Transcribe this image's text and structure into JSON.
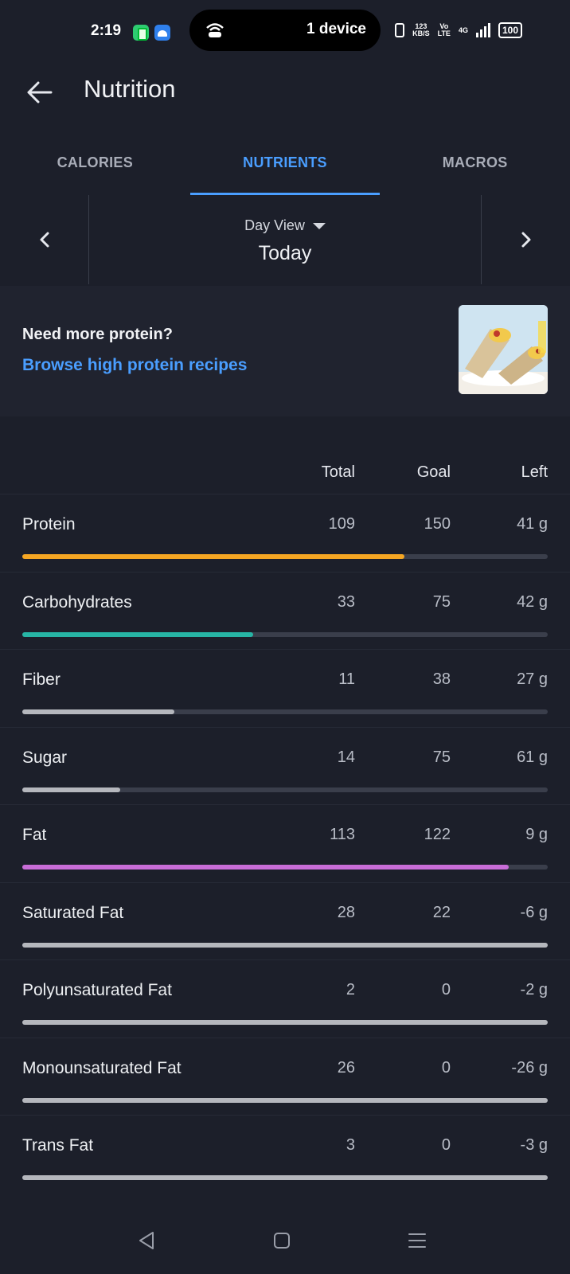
{
  "status_bar": {
    "time": "2:19",
    "pill_text": "1 device",
    "speed_top": "123",
    "speed_bottom": "KB/S",
    "volte_top": "Vo",
    "volte_bottom": "LTE",
    "network": "4G",
    "battery": "100"
  },
  "header": {
    "title": "Nutrition",
    "back_icon": "arrow-left-icon"
  },
  "tabs": [
    {
      "label": "CALORIES",
      "active": false
    },
    {
      "label": "NUTRIENTS",
      "active": true
    },
    {
      "label": "MACROS",
      "active": false
    }
  ],
  "date_nav": {
    "view_label": "Day View",
    "day": "Today"
  },
  "promo": {
    "question": "Need more protein?",
    "link": "Browse high protein recipes"
  },
  "table": {
    "headers": {
      "total": "Total",
      "goal": "Goal",
      "left": "Left"
    },
    "rows": [
      {
        "name": "Protein",
        "total": "109",
        "goal": "150",
        "left": "41 g",
        "progress": 0.727,
        "color": "#f5a623"
      },
      {
        "name": "Carbohydrates",
        "total": "33",
        "goal": "75",
        "left": "42 g",
        "progress": 0.44,
        "color": "#27b5a5"
      },
      {
        "name": "Fiber",
        "total": "11",
        "goal": "38",
        "left": "27 g",
        "progress": 0.29,
        "color": "#b5b7bd"
      },
      {
        "name": "Sugar",
        "total": "14",
        "goal": "75",
        "left": "61 g",
        "progress": 0.187,
        "color": "#b5b7bd"
      },
      {
        "name": "Fat",
        "total": "113",
        "goal": "122",
        "left": "9 g",
        "progress": 0.926,
        "color": "#c86dd7"
      },
      {
        "name": "Saturated Fat",
        "total": "28",
        "goal": "22",
        "left": "-6 g",
        "progress": 1.0,
        "color": "#b5b7bd"
      },
      {
        "name": "Polyunsaturated Fat",
        "total": "2",
        "goal": "0",
        "left": "-2 g",
        "progress": 1.0,
        "color": "#b5b7bd"
      },
      {
        "name": "Monounsaturated Fat",
        "total": "26",
        "goal": "0",
        "left": "-26 g",
        "progress": 1.0,
        "color": "#b5b7bd"
      },
      {
        "name": "Trans Fat",
        "total": "3",
        "goal": "0",
        "left": "-3 g",
        "progress": 1.0,
        "color": "#b5b7bd"
      }
    ]
  },
  "colors": {
    "accent": "#4a9eff",
    "background": "#1c1f2a"
  }
}
